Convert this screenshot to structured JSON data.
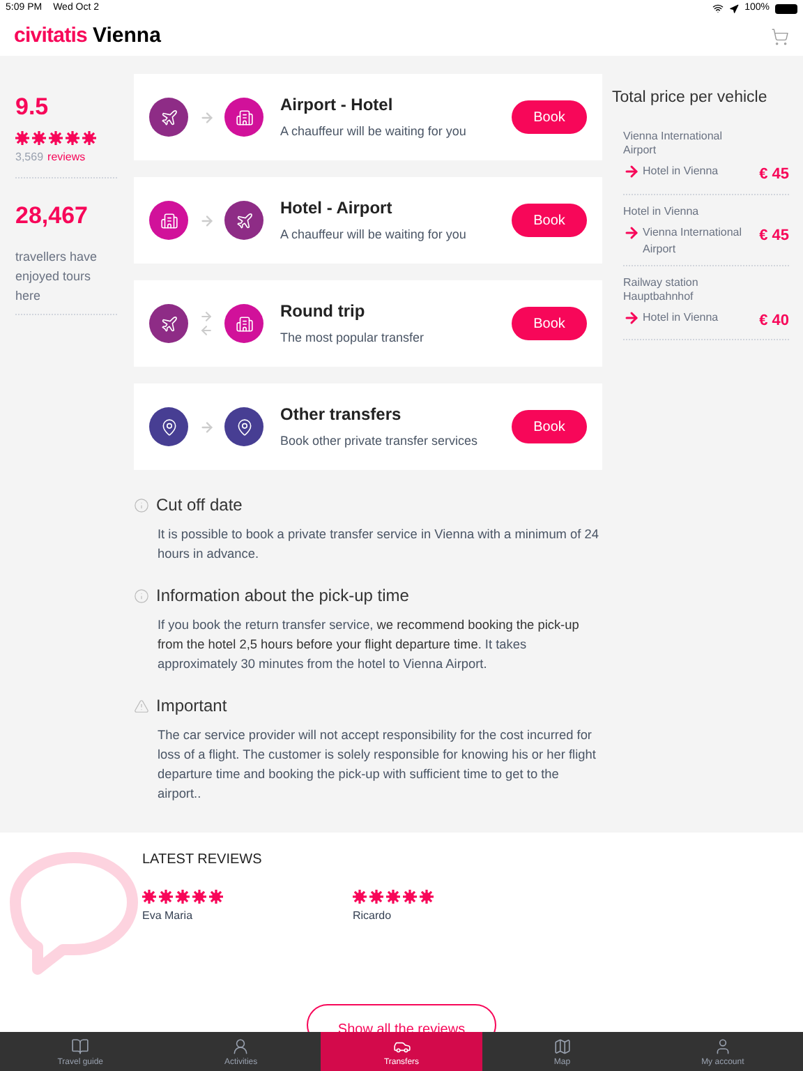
{
  "status_bar": {
    "time": "5:09 PM",
    "date": "Wed Oct 2",
    "battery": "100%"
  },
  "header": {
    "brand": "civitatis",
    "city": "Vienna"
  },
  "stats": {
    "score": "9.5",
    "stars": 5,
    "review_count": "3,569",
    "reviews_link": "reviews",
    "travellers": "28,467",
    "travellers_text": "travellers have enjoyed tours here"
  },
  "transfers": [
    {
      "kind": "one_way",
      "endpoints": [
        {
          "kind": "airport"
        },
        {
          "kind": "hotel"
        }
      ],
      "title": "Airport - Hotel",
      "subtitle": "A chauffeur will be waiting for you",
      "button": "Book"
    },
    {
      "kind": "one_way",
      "endpoints": [
        {
          "kind": "hotel"
        },
        {
          "kind": "airport"
        }
      ],
      "title": "Hotel - Airport",
      "subtitle": "A chauffeur will be waiting for you",
      "button": "Book"
    },
    {
      "kind": "round_trip",
      "endpoints": [
        {
          "kind": "airport"
        },
        {
          "kind": "hotel"
        }
      ],
      "title": "Round trip",
      "subtitle": "The most popular transfer",
      "button": "Book"
    },
    {
      "kind": "one_way",
      "endpoints": [
        {
          "kind": "place"
        },
        {
          "kind": "place"
        }
      ],
      "title": "Other transfers",
      "subtitle": "Book other private transfer services",
      "button": "Book"
    }
  ],
  "info": [
    {
      "kind": "info",
      "title": "Cut off date",
      "text": "It is possible to book a private transfer service in Vienna with a minimum of 24 hours in advance."
    },
    {
      "kind": "info",
      "title": "Information about the pick-up time",
      "text": "If you book the return transfer service, **we recommend booking the pick-up from the hotel 2,5 hours before your flight departure time**. It takes approximately 30 minutes from the hotel to Vienna Airport."
    },
    {
      "kind": "warning",
      "title": "Important",
      "text": "The car service provider will not accept responsibility for the cost incurred for loss of a flight. The customer is solely responsible for knowing his or her flight departure time and booking the pick-up with sufficient time to get to the airport.."
    }
  ],
  "prices": {
    "title": "Total price per vehicle",
    "routes": [
      {
        "from": "Vienna International Airport",
        "to": "Hotel in Vienna",
        "price": "€ 45"
      },
      {
        "from": "Hotel in Vienna",
        "to": "Vienna International Airport",
        "price": "€ 45"
      },
      {
        "from": "Railway station Hauptbahnhof",
        "to": "Hotel in Vienna",
        "price": "€ 40"
      }
    ]
  },
  "reviews": {
    "title": "LATEST REVIEWS",
    "items": [
      {
        "stars": 5,
        "name": "Eva Maria"
      },
      {
        "stars": 5,
        "name": "Ricardo"
      }
    ],
    "button": "Show all the reviews"
  },
  "tab_bar": [
    {
      "kind": "guide",
      "label": "Travel guide",
      "selected": false
    },
    {
      "kind": "activities",
      "label": "Activities",
      "selected": false
    },
    {
      "kind": "transfers",
      "label": "Transfers",
      "selected": true
    },
    {
      "kind": "map",
      "label": "Map",
      "selected": false
    },
    {
      "kind": "account",
      "label": "My account",
      "selected": false
    }
  ]
}
